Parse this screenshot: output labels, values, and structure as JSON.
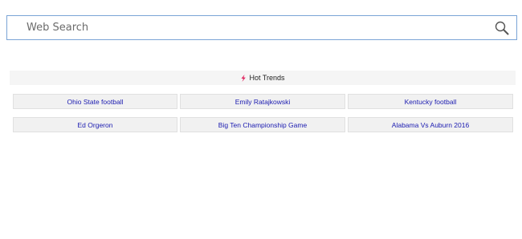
{
  "search": {
    "placeholder": "Web Search",
    "value": ""
  },
  "icons": {
    "search": "magnifier-icon",
    "trends": "flame-icon"
  },
  "colors": {
    "search_border": "#7aa4d6",
    "link": "#1a1ab0",
    "flame": "#e0245e"
  },
  "trends": {
    "title": "Hot Trends",
    "items": [
      {
        "label": "Ohio State football"
      },
      {
        "label": "Emily Ratajkowski"
      },
      {
        "label": "Kentucky football"
      },
      {
        "label": "Ed Orgeron"
      },
      {
        "label": "Big Ten Championship Game"
      },
      {
        "label": "Alabama Vs Auburn 2016"
      }
    ]
  }
}
